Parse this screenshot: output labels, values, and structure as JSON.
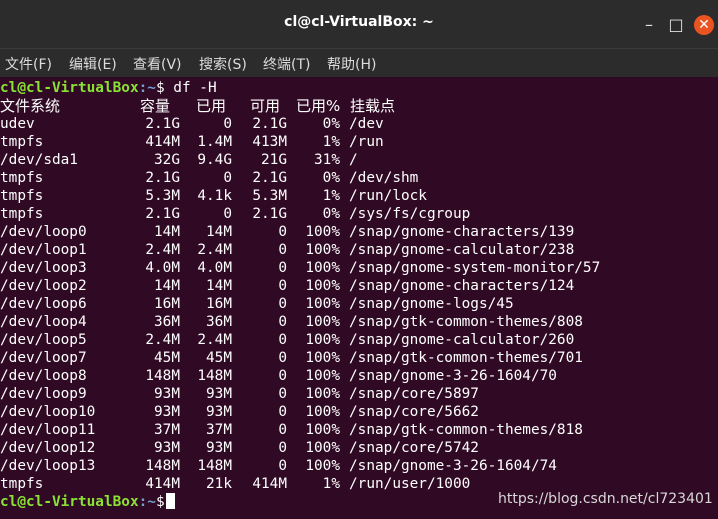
{
  "window": {
    "title": "cl@cl-VirtualBox: ~",
    "min_symbol": "–",
    "max_symbol": "□",
    "close_symbol": "✕"
  },
  "menu": [
    {
      "label": "文件(F)"
    },
    {
      "label": "编辑(E)"
    },
    {
      "label": "查看(V)"
    },
    {
      "label": "搜索(S)"
    },
    {
      "label": "终端(T)"
    },
    {
      "label": "帮助(H)"
    }
  ],
  "prompt": {
    "user_host": "cl@cl-VirtualBox",
    "path": ":~",
    "symbol": "$",
    "command": " df -H"
  },
  "table": {
    "headers": [
      "文件系统",
      "容量",
      "已用",
      "可用",
      "已用%",
      "挂载点"
    ],
    "rows": [
      [
        "udev",
        "2.1G",
        "0",
        "2.1G",
        "0%",
        "/dev"
      ],
      [
        "tmpfs",
        "414M",
        "1.4M",
        "413M",
        "1%",
        "/run"
      ],
      [
        "/dev/sda1",
        "32G",
        "9.4G",
        "21G",
        "31%",
        "/"
      ],
      [
        "tmpfs",
        "2.1G",
        "0",
        "2.1G",
        "0%",
        "/dev/shm"
      ],
      [
        "tmpfs",
        "5.3M",
        "4.1k",
        "5.3M",
        "1%",
        "/run/lock"
      ],
      [
        "tmpfs",
        "2.1G",
        "0",
        "2.1G",
        "0%",
        "/sys/fs/cgroup"
      ],
      [
        "/dev/loop0",
        "14M",
        "14M",
        "0",
        "100%",
        "/snap/gnome-characters/139"
      ],
      [
        "/dev/loop1",
        "2.4M",
        "2.4M",
        "0",
        "100%",
        "/snap/gnome-calculator/238"
      ],
      [
        "/dev/loop3",
        "4.0M",
        "4.0M",
        "0",
        "100%",
        "/snap/gnome-system-monitor/57"
      ],
      [
        "/dev/loop2",
        "14M",
        "14M",
        "0",
        "100%",
        "/snap/gnome-characters/124"
      ],
      [
        "/dev/loop6",
        "16M",
        "16M",
        "0",
        "100%",
        "/snap/gnome-logs/45"
      ],
      [
        "/dev/loop4",
        "36M",
        "36M",
        "0",
        "100%",
        "/snap/gtk-common-themes/808"
      ],
      [
        "/dev/loop5",
        "2.4M",
        "2.4M",
        "0",
        "100%",
        "/snap/gnome-calculator/260"
      ],
      [
        "/dev/loop7",
        "45M",
        "45M",
        "0",
        "100%",
        "/snap/gtk-common-themes/701"
      ],
      [
        "/dev/loop8",
        "148M",
        "148M",
        "0",
        "100%",
        "/snap/gnome-3-26-1604/70"
      ],
      [
        "/dev/loop9",
        "93M",
        "93M",
        "0",
        "100%",
        "/snap/core/5897"
      ],
      [
        "/dev/loop10",
        "93M",
        "93M",
        "0",
        "100%",
        "/snap/core/5662"
      ],
      [
        "/dev/loop11",
        "37M",
        "37M",
        "0",
        "100%",
        "/snap/gtk-common-themes/818"
      ],
      [
        "/dev/loop12",
        "93M",
        "93M",
        "0",
        "100%",
        "/snap/core/5742"
      ],
      [
        "/dev/loop13",
        "148M",
        "148M",
        "0",
        "100%",
        "/snap/gnome-3-26-1604/74"
      ],
      [
        "tmpfs",
        "414M",
        "21k",
        "414M",
        "1%",
        "/run/user/1000"
      ]
    ]
  },
  "watermark": "https://blog.csdn.net/cl723401",
  "colors": {
    "background": "#300a24",
    "prompt_user": "#8ae234",
    "prompt_path": "#729fcf",
    "close_button": "#e95420"
  }
}
